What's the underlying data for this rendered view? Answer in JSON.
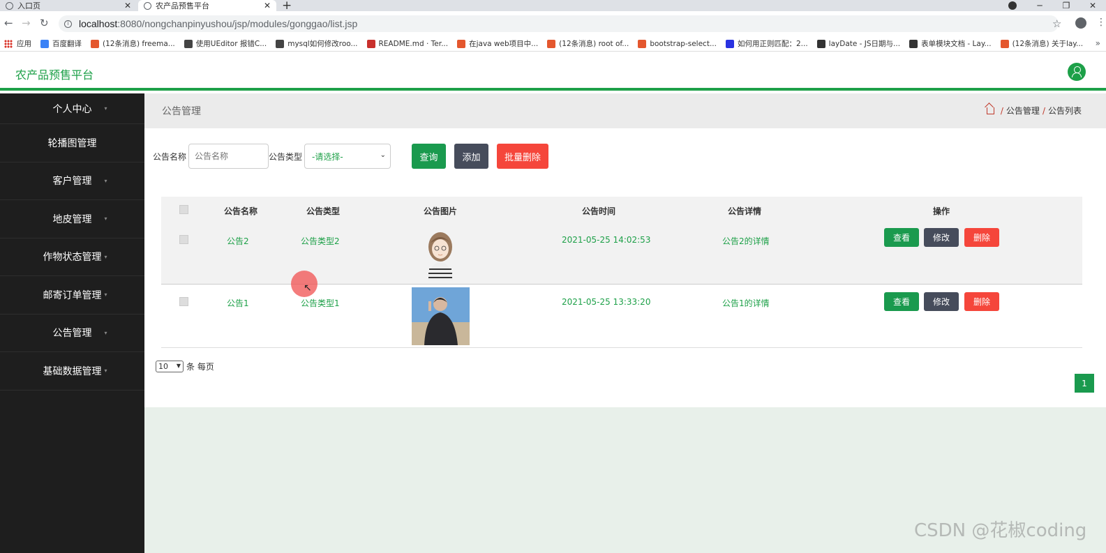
{
  "browser": {
    "tabs": [
      {
        "label": "入口页",
        "active": false
      },
      {
        "label": "农产品预售平台",
        "active": true
      }
    ],
    "url_host": "localhost",
    "url_path": ":8080/nongchanpinyushou/jsp/modules/gonggao/list.jsp",
    "bookmarks": [
      "应用",
      "百度翻译",
      "(12条消息) freema...",
      "使用UEditor 报错C...",
      "mysql如何修改roo...",
      "README.md · Ter...",
      "在java web项目中...",
      "(12条消息) root of...",
      "bootstrap-select...",
      "如何用正则匹配：2...",
      "layDate - JS日期与...",
      "表单模块文档 - Lay...",
      "(12条消息) 关于lay..."
    ],
    "bookmark_colors": [
      "#d93025",
      "#3b82f6",
      "#e4572e",
      "#444444",
      "#444444",
      "#c9302c",
      "#e4572e",
      "#e4572e",
      "#e4572e",
      "#2932e1",
      "#333333",
      "#333333",
      "#e4572e"
    ]
  },
  "app": {
    "title": "农产品预售平台",
    "accent_color": "#1da048"
  },
  "sidebar": {
    "items": [
      "个人中心",
      "轮播图管理",
      "客户管理",
      "地皮管理",
      "作物状态管理",
      "邮寄订单管理",
      "公告管理",
      "基础数据管理"
    ]
  },
  "page": {
    "title": "公告管理",
    "breadcrumb": [
      "公告管理",
      "公告列表"
    ]
  },
  "search": {
    "name_label": "公告名称",
    "name_placeholder": "公告名称",
    "type_label": "公告类型",
    "type_selected": "-请选择-",
    "query_btn": "查询",
    "add_btn": "添加",
    "batch_delete_btn": "批量删除"
  },
  "table": {
    "headers": [
      "公告名称",
      "公告类型",
      "公告图片",
      "公告时间",
      "公告详情",
      "操作"
    ],
    "rows": [
      {
        "name": "公告2",
        "type": "公告类型2",
        "time": "2021-05-25 14:02:53",
        "detail": "公告2的详情",
        "image": "girl-illustration"
      },
      {
        "name": "公告1",
        "type": "公告类型1",
        "time": "2021-05-25 13:33:20",
        "detail": "公告1的详情",
        "image": "person-photo"
      }
    ],
    "actions": {
      "view": "查看",
      "edit": "修改",
      "delete": "删除"
    }
  },
  "pager": {
    "page_size": "10",
    "per_page_label": "条 每页",
    "current_page": "1"
  },
  "watermark": "CSDN @花椒coding"
}
